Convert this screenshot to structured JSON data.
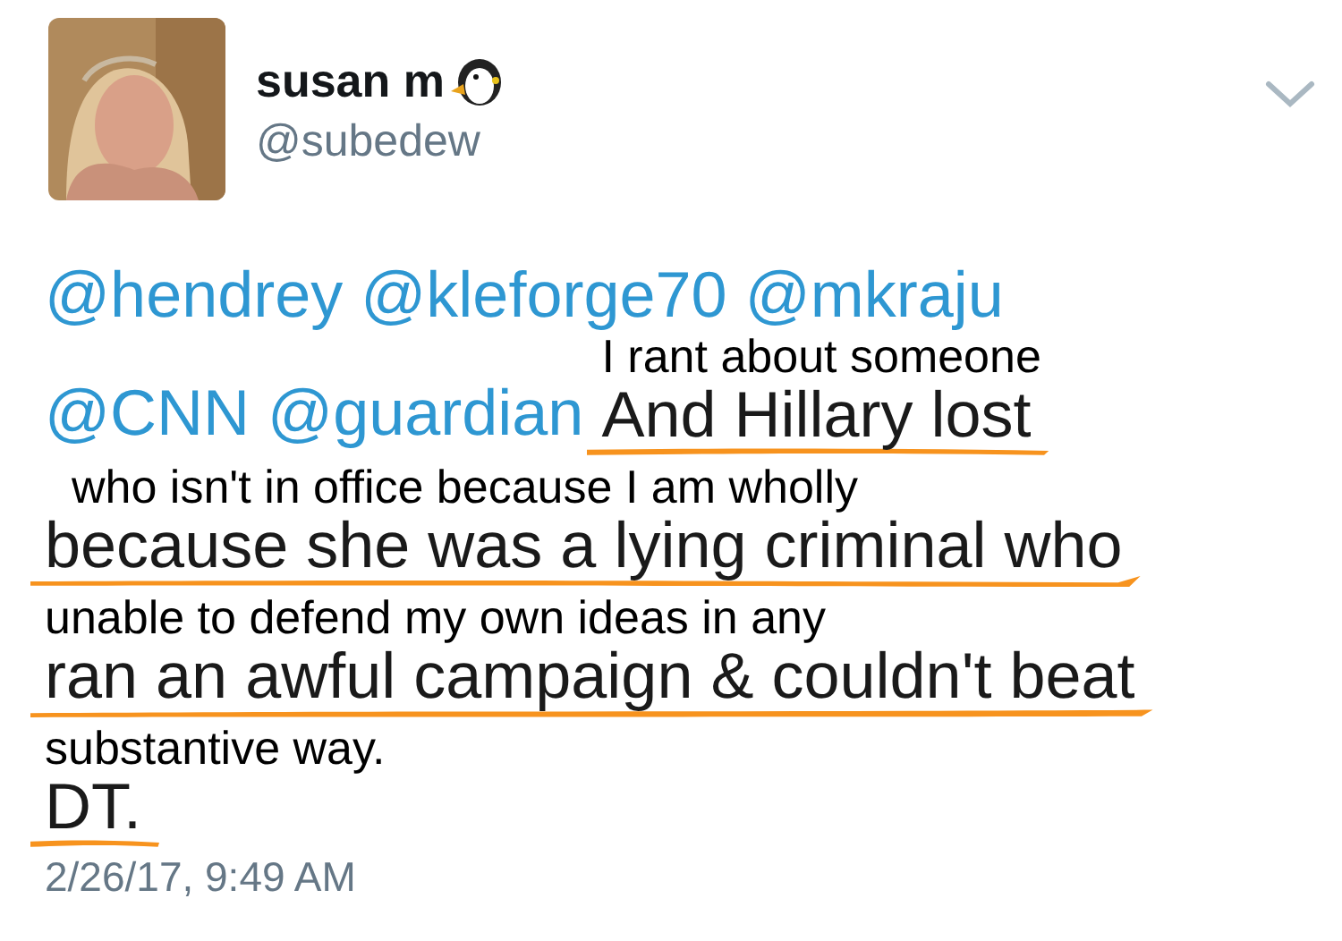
{
  "author": {
    "name": "susan m",
    "handle": "@subedew"
  },
  "tweet": {
    "lines": [
      {
        "mentions": [
          "@hendrey",
          "@kleforge70",
          "@mkraju"
        ]
      },
      {
        "mentions": [
          "@CNN",
          "@guardian"
        ],
        "text": "And Hillary lost",
        "annotation": "I rant about someone"
      },
      {
        "text": "because she was a lying criminal who",
        "annotation": "who isn't in office because I am wholly"
      },
      {
        "text": "ran an awful campaign & couldn't beat",
        "annotation": "unable to defend my own ideas in any"
      },
      {
        "text": "DT.",
        "annotation": "substantive way."
      }
    ]
  },
  "timestamp": "2/26/17, 9:49 AM"
}
